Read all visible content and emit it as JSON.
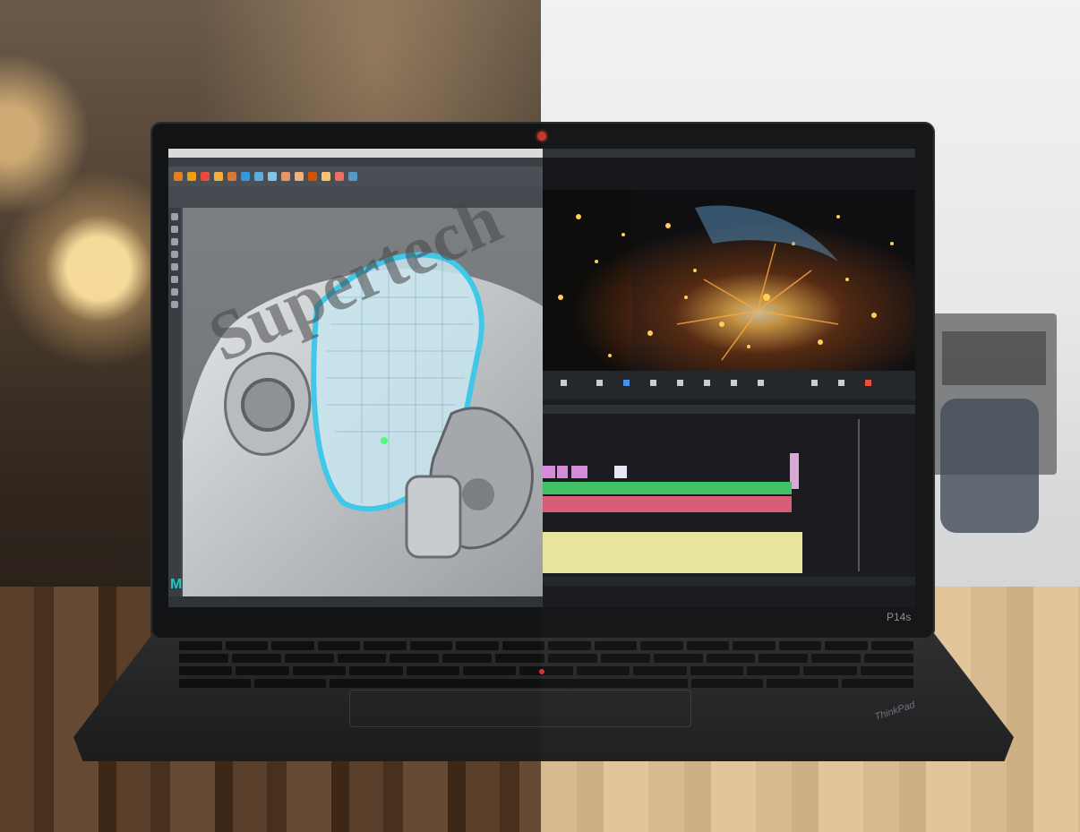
{
  "laptop": {
    "model_label": "P14s",
    "brand_logo": "ThinkPad"
  },
  "watermark": "Supertech",
  "screen": {
    "left_app": {
      "logo": "M",
      "icon": "maya-logo-icon"
    }
  },
  "colors": {
    "maya_accent": "#1fc6c6",
    "timecode": "#e7c55a",
    "webcam_led": "#c0392b",
    "trackpoint": "#d0342c"
  }
}
